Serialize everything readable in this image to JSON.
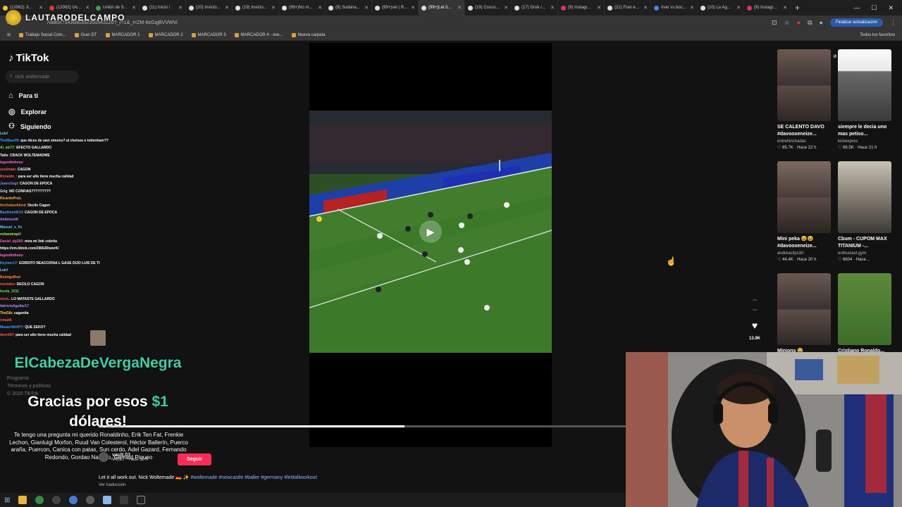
{
  "overlay": {
    "channel": "LAUTARODELCAMPO"
  },
  "browser": {
    "tabs": [
      {
        "title": "(12062) Ji..."
      },
      {
        "title": "(12062) Un..."
      },
      {
        "title": "Unión de S..."
      },
      {
        "title": "(11) Inicio /"
      },
      {
        "title": "(20) Invicto..."
      },
      {
        "title": "(19) Invicto..."
      },
      {
        "title": "(99+)No m..."
      },
      {
        "title": "(8) Sudana..."
      },
      {
        "title": "(99+)sel | R..."
      },
      {
        "title": "(99+)Let it..."
      },
      {
        "title": "(19) Cosco..."
      },
      {
        "title": "(17) Grok /..."
      },
      {
        "title": "(9) Instagr..."
      },
      {
        "title": "(21) Fran e..."
      },
      {
        "title": "river vs boc..."
      },
      {
        "title": "(10) La Ag..."
      },
      {
        "title": "(9) Instagr..."
      }
    ],
    "url": "/video/7543686392350543126?_r=1&_t=ZM-8zGqjBVVWVi",
    "update_label": "Finalizar actualización",
    "bookmarks": [
      "Trabajo Social Com...",
      "Gran DT",
      "MARCADOR 1",
      "MARCADOR 2",
      "MARCADOR 3",
      "MARCADOR 4 - ove...",
      "Nueva carpeta"
    ],
    "all_bookmarks": "Todos los favoritos"
  },
  "sidebar": {
    "logo": "TikTok",
    "search_placeholder": "nick woltemade",
    "nav": [
      {
        "label": "Para ti"
      },
      {
        "label": "Explorar"
      },
      {
        "label": "Siguiendo"
      }
    ],
    "footer": [
      "Programa",
      "Términos y políticas",
      "© 2025 TikTok"
    ]
  },
  "chat": [
    {
      "user": "Leiz!",
      "msg": "",
      "color": "#7cd6ff"
    },
    {
      "user": "TheMaor09",
      "msg": "que dices de xavi simons? al chelsea o tottenham??",
      "color": "#3aa0ff"
    },
    {
      "user": "Al_aki77",
      "msg": "EFECTO GALLARDO",
      "color": "#5de35d"
    },
    {
      "user": "Tatis",
      "msg": "CRACK WOLTEMADWE",
      "color": "#ffffff"
    },
    {
      "user": "legendinhooo",
      "msg": "",
      "color": "#ff6ad5"
    },
    {
      "user": "soulmate",
      "msg": "CAGON",
      "color": "#ff5a5a"
    },
    {
      "user": "Ronaldo_",
      "msg": "para ser alto tiene mucha calidad",
      "color": "#ff5a5a"
    },
    {
      "user": "Juanchugt",
      "msg": "CAGON DE EPOCA",
      "color": "#9b7cff"
    },
    {
      "user": "Grig",
      "msg": "NO CONFIAS?????????",
      "color": "#d0e0ff"
    },
    {
      "user": "RicardoPnzL",
      "msg": "",
      "color": "#ffb347"
    },
    {
      "user": "ferchobeckford",
      "msg": "Decilo Cagon",
      "color": "#ff8a3d"
    },
    {
      "user": "Bautiismilli13",
      "msg": "CAGON DE EPOCA",
      "color": "#3aa0ff"
    },
    {
      "user": "Ambrocelli",
      "msg": "",
      "color": "#b48cff"
    },
    {
      "user": "Manuel_s_Kz",
      "msg": "",
      "color": "#5ec8ff"
    },
    {
      "user": "nobaratrapU",
      "msg": "",
      "color": "#a8e05a"
    },
    {
      "user": "Daniel_dp266",
      "msg": "mira mi link cobrita",
      "color": "#ff5ab4"
    },
    {
      "user": "https://vm.tiktok.com/ZMA2RwwrK/",
      "msg": "",
      "color": "#ffffff"
    },
    {
      "user": "legendinhooo",
      "msg": "",
      "color": "#ff6ad5"
    },
    {
      "user": "Keymer17",
      "msg": "GORDITO REACCIONA L GAUE DIJO LUIS DE TI",
      "color": "#3aa0ff"
    },
    {
      "user": "Leiz!",
      "msg": "",
      "color": "#7cd6ff"
    },
    {
      "user": "RodrigoBod",
      "msg": "",
      "color": "#ff8a3d"
    },
    {
      "user": "mortales",
      "msg": "DECILO CAGON",
      "color": "#ff5a5a"
    },
    {
      "user": "busta_2211",
      "msg": "",
      "color": "#5de35d"
    },
    {
      "user": "nicoL",
      "msg": "LO MATASTE GALLARDO",
      "color": "#ff5a5a"
    },
    {
      "user": "fabricioAguilar17",
      "msg": "",
      "color": "#b48cff"
    },
    {
      "user": "TheGib",
      "msg": "cagonita",
      "color": "#ffd24a"
    },
    {
      "user": "ronaldi",
      "msg": "",
      "color": "#ff5a5a"
    },
    {
      "user": "MasterWolf77",
      "msg": "QUE ZEKO?",
      "color": "#3aa0ff"
    },
    {
      "user": "Aver007",
      "msg": "para ser alto tiene mucha calidad",
      "color": "#ff5a5a"
    }
  ],
  "video": {
    "like_count": "13.9K",
    "author": "vault.03",
    "posted": "VAULT · Hace 10 h",
    "follow_label": "Seguir",
    "caption_text": "Let it all work out. Nick Woltemade 🇩🇪 ✨",
    "caption_tags": "#woltemade #newcastle #baller #germany #letitallworkout",
    "translate_label": "Ver traducción",
    "progress_fraction": 0.58
  },
  "related": [
    {
      "title": "SE CALENTÓ DAVO #davooxeneize...",
      "author": "entrehinchadas",
      "likes": "85.7K",
      "age": "Hace 22 h"
    },
    {
      "title": "siempre le decia uno mas petiso...",
      "author": "kickexpres",
      "likes": "66.5K",
      "age": "Hace 21 h"
    },
    {
      "title": "Mini peka 😆😆 #davooxeneize...",
      "author": "andreaclips3rt",
      "likes": "44.4K",
      "age": "Hace 20 h"
    },
    {
      "title": "Cbum - CUPOM MAX TITANIUM -...",
      "author": "enthusiast.gym",
      "likes": "6604",
      "age": "Hace..."
    },
    {
      "title": "Minions 😂",
      "author": "",
      "likes": "",
      "age": ""
    },
    {
      "title": "Cristiano Ronaldo...",
      "author": "",
      "likes": "",
      "age": ""
    }
  ],
  "donation": {
    "donor": "ElCabezaDeVergaNegra",
    "thanks_prefix": "Gracias por esos",
    "amount": "$1",
    "thanks_suffix": "dólares!",
    "message": "Te tengo una pregunta mi querido Ronaldinho, Erik Ten Fat, Frenkie Lechon, Gianluigi Morfon, Ruud Van Colesterol, Héctor Ballerín, Puerco araña, Puercon, Canica con patas, Sun cerdo, Adel Gazard, Fernando Redondo, Gordao Nazario, Gerrard Piqueo"
  },
  "colors": {
    "tiktok_red": "#fe2c55",
    "donation_green": "#39d3a6",
    "pitch_green": "#3c7a2a"
  }
}
